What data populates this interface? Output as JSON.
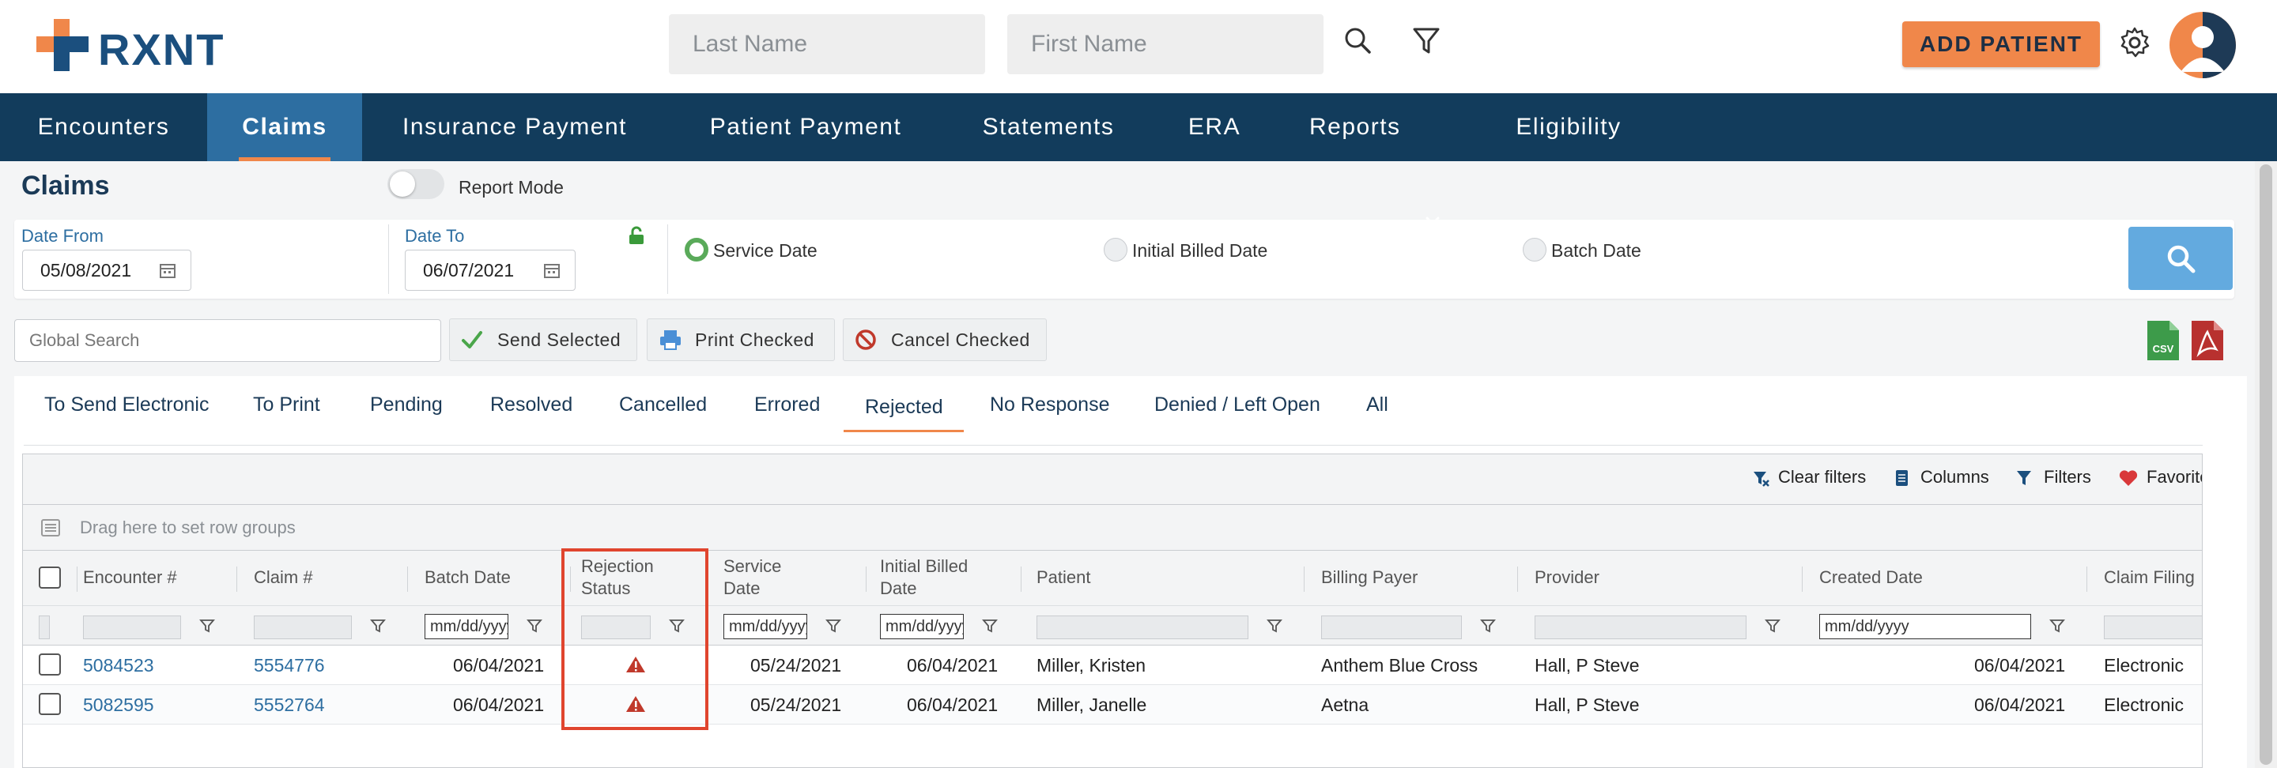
{
  "header": {
    "logo_text": "RXNT",
    "last_name_placeholder": "Last Name",
    "first_name_placeholder": "First Name",
    "add_patient_label": "ADD PATIENT",
    "brand_blue": "#1b4f7e",
    "accent_orange": "#f0874a"
  },
  "nav": {
    "items": [
      "Encounters",
      "Claims",
      "Insurance Payment",
      "Patient Payment",
      "Statements",
      "ERA",
      "Reports",
      "Eligibility"
    ],
    "active": "Claims"
  },
  "page": {
    "title": "Claims",
    "report_mode_label": "Report Mode",
    "report_mode_on": false
  },
  "filters": {
    "date_from_label": "Date From",
    "date_from_value": "05/08/2021",
    "date_to_label": "Date To",
    "date_to_value": "06/07/2021",
    "radio_options": [
      "Service Date",
      "Initial Billed Date",
      "Batch Date"
    ],
    "radio_selected": "Service Date"
  },
  "actions": {
    "global_search_placeholder": "Global Search",
    "send_selected": "Send Selected",
    "print_checked": "Print Checked",
    "cancel_checked": "Cancel Checked",
    "csv_label": "CSV"
  },
  "tabs": {
    "items": [
      "To Send Electronic",
      "To Print",
      "Pending",
      "Resolved",
      "Cancelled",
      "Errored",
      "Rejected",
      "No Response",
      "Denied / Left Open",
      "All"
    ],
    "active": "Rejected"
  },
  "grid_toolbar": {
    "clear_filters": "Clear filters",
    "columns": "Columns",
    "filters": "Filters",
    "favorites": "Favorites",
    "group_hint": "Drag here to set row groups"
  },
  "grid": {
    "headers": {
      "encounter": "Encounter #",
      "claim": "Claim #",
      "batch_date": "Batch Date",
      "rejection_status_1": "Rejection",
      "rejection_status_2": "Status",
      "service_date_1": "Service",
      "service_date_2": "Date",
      "initial_billed_1": "Initial Billed",
      "initial_billed_2": "Date",
      "patient": "Patient",
      "billing_payer": "Billing Payer",
      "provider": "Provider",
      "created_date": "Created Date",
      "claim_filing": "Claim Filing"
    },
    "filter_placeholders": {
      "short_date": "mm/dd/yyyy",
      "created_date": "mm/dd/yyyy"
    },
    "rows": [
      {
        "encounter": "5084523",
        "claim": "5554776",
        "batch_date": "06/04/2021",
        "rejection_icon": "warning-icon",
        "service_date": "05/24/2021",
        "initial_billed": "06/04/2021",
        "patient": "Miller, Kristen",
        "billing_payer": "Anthem Blue Cross",
        "provider": "Hall, P Steve",
        "created_date": "06/04/2021",
        "claim_filing": "Electronic"
      },
      {
        "encounter": "5082595",
        "claim": "5552764",
        "batch_date": "06/04/2021",
        "rejection_icon": "warning-icon",
        "service_date": "05/24/2021",
        "initial_billed": "06/04/2021",
        "patient": "Miller, Janelle",
        "billing_payer": "Aetna",
        "provider": "Hall, P Steve",
        "created_date": "06/04/2021",
        "claim_filing": "Electronic"
      }
    ]
  }
}
